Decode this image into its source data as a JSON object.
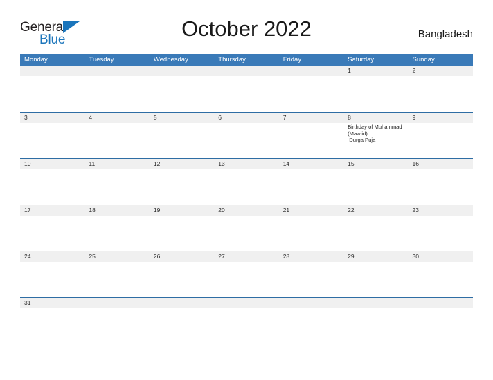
{
  "brand": {
    "name_top": "General",
    "name_bottom": "Blue",
    "accent_color": "#1b75bb"
  },
  "header": {
    "title": "October 2022",
    "country": "Bangladesh"
  },
  "theme": {
    "header_blue": "#3a7ab8",
    "rule_blue": "#2e6da4",
    "date_band_gray": "#f0f0f0",
    "text_color": "#1a1a1a"
  },
  "calendar": {
    "weekdays": [
      "Monday",
      "Tuesday",
      "Wednesday",
      "Thursday",
      "Friday",
      "Saturday",
      "Sunday"
    ],
    "weeks": [
      {
        "days": [
          {
            "date": "",
            "events": []
          },
          {
            "date": "",
            "events": []
          },
          {
            "date": "",
            "events": []
          },
          {
            "date": "",
            "events": []
          },
          {
            "date": "",
            "events": []
          },
          {
            "date": "1",
            "events": []
          },
          {
            "date": "2",
            "events": []
          }
        ]
      },
      {
        "days": [
          {
            "date": "3",
            "events": []
          },
          {
            "date": "4",
            "events": []
          },
          {
            "date": "5",
            "events": []
          },
          {
            "date": "6",
            "events": []
          },
          {
            "date": "7",
            "events": []
          },
          {
            "date": "8",
            "events": [
              "Birthday of Muhammad (Mawlid)",
              " Durga Puja"
            ]
          },
          {
            "date": "9",
            "events": []
          }
        ]
      },
      {
        "days": [
          {
            "date": "10",
            "events": []
          },
          {
            "date": "11",
            "events": []
          },
          {
            "date": "12",
            "events": []
          },
          {
            "date": "13",
            "events": []
          },
          {
            "date": "14",
            "events": []
          },
          {
            "date": "15",
            "events": []
          },
          {
            "date": "16",
            "events": []
          }
        ]
      },
      {
        "days": [
          {
            "date": "17",
            "events": []
          },
          {
            "date": "18",
            "events": []
          },
          {
            "date": "19",
            "events": []
          },
          {
            "date": "20",
            "events": []
          },
          {
            "date": "21",
            "events": []
          },
          {
            "date": "22",
            "events": []
          },
          {
            "date": "23",
            "events": []
          }
        ]
      },
      {
        "days": [
          {
            "date": "24",
            "events": []
          },
          {
            "date": "25",
            "events": []
          },
          {
            "date": "26",
            "events": []
          },
          {
            "date": "27",
            "events": []
          },
          {
            "date": "28",
            "events": []
          },
          {
            "date": "29",
            "events": []
          },
          {
            "date": "30",
            "events": []
          }
        ]
      },
      {
        "days": [
          {
            "date": "31",
            "events": []
          },
          {
            "date": "",
            "events": []
          },
          {
            "date": "",
            "events": []
          },
          {
            "date": "",
            "events": []
          },
          {
            "date": "",
            "events": []
          },
          {
            "date": "",
            "events": []
          },
          {
            "date": "",
            "events": []
          }
        ]
      }
    ]
  }
}
